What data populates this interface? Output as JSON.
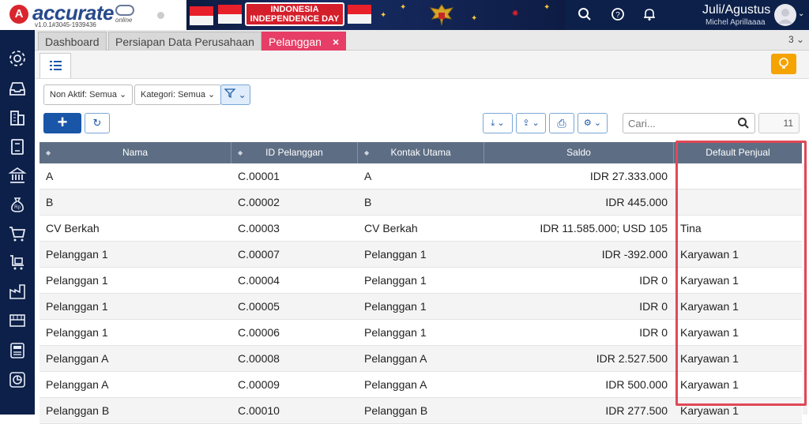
{
  "app": {
    "logo_mark": "A",
    "logo_name": "accurate",
    "logo_sub": "online",
    "version": "v1.0.1#3045-1939436",
    "banner_line1": "INDONESIA",
    "banner_line2": "INDEPENDENCE DAY",
    "user_name": "Juli/Agustus",
    "user_sub": "Michel Aprillaaaa"
  },
  "tabs": [
    {
      "label": "Dashboard"
    },
    {
      "label": "Persiapan Data Perusahaan"
    },
    {
      "label": "Pelanggan",
      "close": "×"
    }
  ],
  "tab_count": "3 ⌄",
  "filters": {
    "non_aktif": "Non Aktif: Semua ⌄",
    "kategori": "Kategori: Semua ⌄",
    "funnel": "⌄"
  },
  "toolbar": {
    "add": "+",
    "refresh": "↻",
    "download": "⤓ ⌄",
    "export": "⇪ ⌄",
    "print": "⎙",
    "settings": "⚙ ⌄",
    "search_placeholder": "Cari...",
    "count": "11"
  },
  "table": {
    "columns": [
      "Nama",
      "ID Pelanggan",
      "Kontak Utama",
      "Saldo",
      "Default Penjual"
    ],
    "rows": [
      [
        "A",
        "C.00001",
        "A",
        "IDR 27.333.000",
        ""
      ],
      [
        "B",
        "C.00002",
        "B",
        "IDR 445.000",
        ""
      ],
      [
        "CV Berkah",
        "C.00003",
        "CV Berkah",
        "IDR 11.585.000; USD 105",
        "Tina"
      ],
      [
        "Pelanggan 1",
        "C.00007",
        "Pelanggan 1",
        "IDR -392.000",
        "Karyawan 1"
      ],
      [
        "Pelanggan 1",
        "C.00004",
        "Pelanggan 1",
        "IDR 0",
        "Karyawan 1"
      ],
      [
        "Pelanggan 1",
        "C.00005",
        "Pelanggan 1",
        "IDR 0",
        "Karyawan 1"
      ],
      [
        "Pelanggan 1",
        "C.00006",
        "Pelanggan 1",
        "IDR 0",
        "Karyawan 1"
      ],
      [
        "Pelanggan A",
        "C.00008",
        "Pelanggan A",
        "IDR 2.527.500",
        "Karyawan 1"
      ],
      [
        "Pelanggan A",
        "C.00009",
        "Pelanggan A",
        "IDR 500.000",
        "Karyawan 1"
      ],
      [
        "Pelanggan B",
        "C.00010",
        "Pelanggan B",
        "IDR 277.500",
        "Karyawan 1"
      ]
    ]
  },
  "colors": {
    "topbar": "#0c2049",
    "active_tab": "#e63e66",
    "primary": "#1a56a8",
    "table_header": "#5d6e84",
    "highlight": "#e04858",
    "bulb": "#f5a300"
  },
  "icons": {
    "sidebar": [
      "gear-icon",
      "inbox-tray-icon",
      "building-icon",
      "book-icon",
      "bank-icon",
      "money-bag-icon",
      "cart-icon",
      "shopping-cart-icon",
      "factory-icon",
      "warehouse-icon",
      "tax-icon",
      "chart-icon"
    ]
  }
}
